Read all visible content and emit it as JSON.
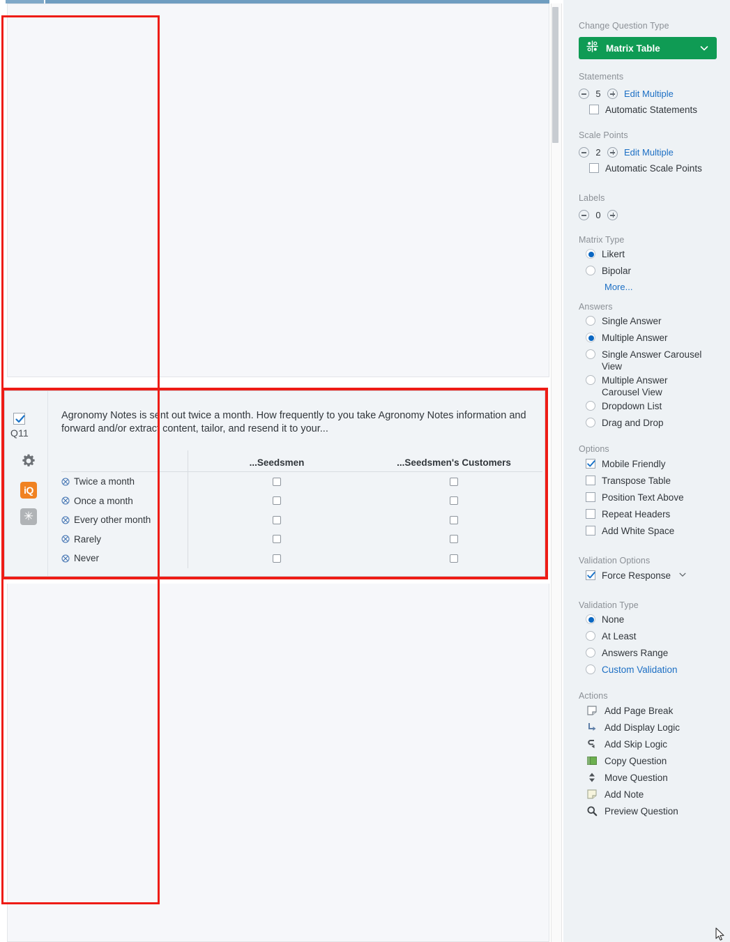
{
  "question": {
    "number": "Q11",
    "selected_checkbox": true,
    "text": "Agronomy Notes is sent out twice a month.  How frequently to you take Agronomy Notes information and forward and/or extract content, tailor, and resend it to your...",
    "gutter_icons": [
      "checkbox-icon",
      "gear-icon",
      "iq-icon",
      "asterisk-icon"
    ],
    "iq_label": "iQ",
    "asterisk_label": "✳",
    "matrix": {
      "columns": [
        "...Seedsmen",
        "...Seedsmen's Customers"
      ],
      "statements": [
        "Twice a month",
        "Once a month",
        "Every other month",
        "Rarely",
        "Never"
      ],
      "cell_state": "unchecked"
    }
  },
  "properties": {
    "change_question_type": {
      "section_label": "Change Question Type",
      "selected": "Matrix Table",
      "icon": "matrix-table-icon",
      "accent_color": "#0f9b54"
    },
    "statements": {
      "section_label": "Statements",
      "count": "5",
      "edit_multiple_label": "Edit Multiple",
      "automatic_label": "Automatic Statements",
      "automatic_checked": false
    },
    "scale_points": {
      "section_label": "Scale Points",
      "count": "2",
      "edit_multiple_label": "Edit Multiple",
      "automatic_label": "Automatic Scale Points",
      "automatic_checked": false
    },
    "labels": {
      "section_label": "Labels",
      "count": "0"
    },
    "matrix_type": {
      "section_label": "Matrix Type",
      "options": [
        {
          "label": "Likert",
          "selected": true
        },
        {
          "label": "Bipolar",
          "selected": false
        }
      ],
      "more_label": "More..."
    },
    "answers": {
      "section_label": "Answers",
      "options": [
        {
          "label": "Single Answer",
          "selected": false
        },
        {
          "label": "Multiple Answer",
          "selected": true
        },
        {
          "label": "Single Answer Carousel View",
          "selected": false
        },
        {
          "label": "Multiple Answer Carousel View",
          "selected": false
        },
        {
          "label": "Dropdown List",
          "selected": false
        },
        {
          "label": "Drag and Drop",
          "selected": false
        }
      ]
    },
    "options": {
      "section_label": "Options",
      "items": [
        {
          "label": "Mobile Friendly",
          "checked": true
        },
        {
          "label": "Transpose Table",
          "checked": false
        },
        {
          "label": "Position Text Above",
          "checked": false
        },
        {
          "label": "Repeat Headers",
          "checked": false
        },
        {
          "label": "Add White Space",
          "checked": false
        }
      ]
    },
    "validation_options": {
      "section_label": "Validation Options",
      "force_response": {
        "label": "Force Response",
        "checked": true,
        "has_chevron": true
      }
    },
    "validation_type": {
      "section_label": "Validation Type",
      "options": [
        {
          "label": "None",
          "selected": true,
          "link": false
        },
        {
          "label": "At Least",
          "selected": false,
          "link": false
        },
        {
          "label": "Answers Range",
          "selected": false,
          "link": false
        },
        {
          "label": "Custom Validation",
          "selected": false,
          "link": true
        }
      ]
    },
    "actions": {
      "section_label": "Actions",
      "items": [
        {
          "label": "Add Page Break",
          "icon": "page-break-icon"
        },
        {
          "label": "Add Display Logic",
          "icon": "display-logic-icon"
        },
        {
          "label": "Add Skip Logic",
          "icon": "skip-logic-icon"
        },
        {
          "label": "Copy Question",
          "icon": "copy-icon"
        },
        {
          "label": "Move Question",
          "icon": "move-icon"
        },
        {
          "label": "Add Note",
          "icon": "note-icon"
        },
        {
          "label": "Preview Question",
          "icon": "magnifier-icon"
        }
      ]
    }
  },
  "highlight_color": "#ee1c16"
}
